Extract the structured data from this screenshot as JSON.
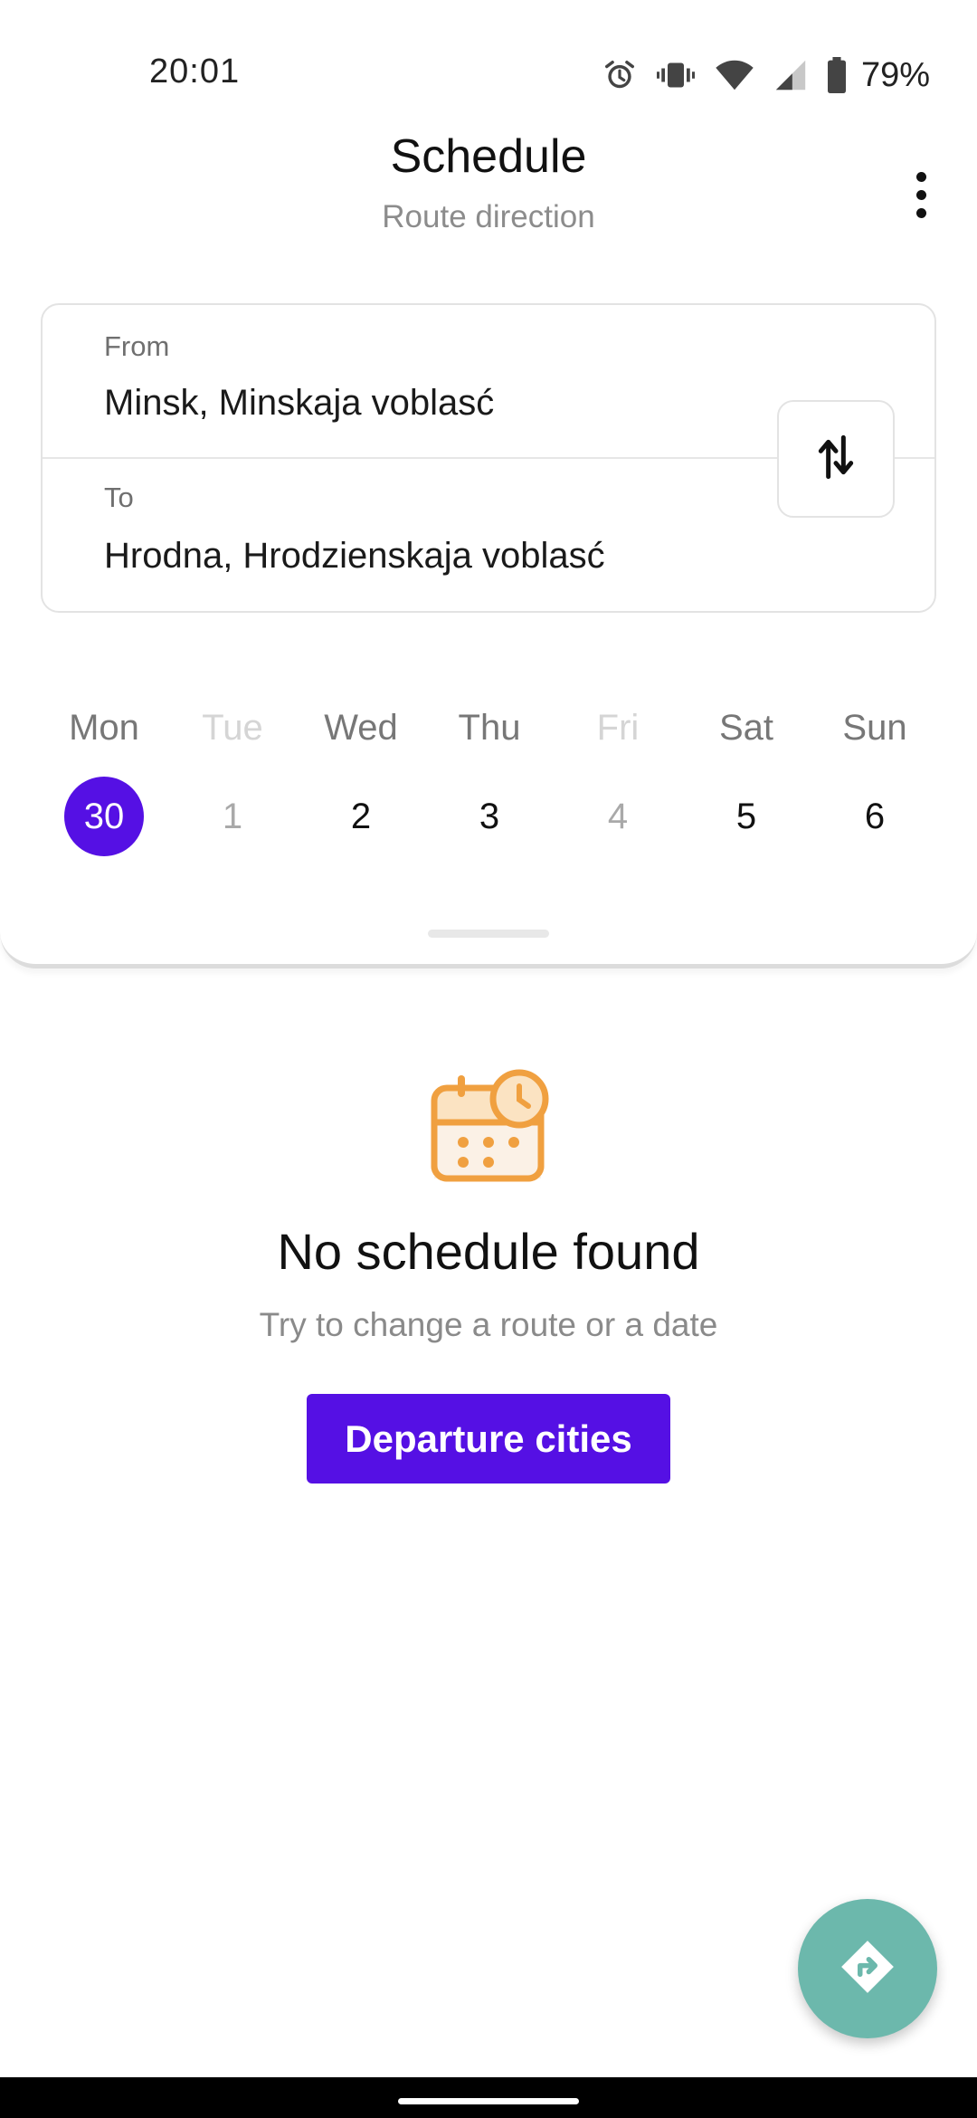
{
  "status_bar": {
    "time": "20:01",
    "battery_percent": "79%",
    "icons": [
      "alarm-icon",
      "vibrate-icon",
      "wifi-icon",
      "cell-signal-icon",
      "battery-icon"
    ]
  },
  "header": {
    "title": "Schedule",
    "subtitle": "Route direction",
    "menu_icon": "more-vertical-icon"
  },
  "route": {
    "from_label": "From",
    "from_value": "Minsk, Minskaja voblasć",
    "to_label": "To",
    "to_value": "Hrodna, Hrodzienskaja voblasć",
    "swap_icon": "swap-vertical-icon"
  },
  "week": {
    "days": [
      {
        "name": "Mon",
        "num": "30",
        "state": "selected"
      },
      {
        "name": "Tue",
        "num": "1",
        "state": "disabled"
      },
      {
        "name": "Wed",
        "num": "2",
        "state": "normal"
      },
      {
        "name": "Thu",
        "num": "3",
        "state": "normal"
      },
      {
        "name": "Fri",
        "num": "4",
        "state": "disabled"
      },
      {
        "name": "Sat",
        "num": "5",
        "state": "normal"
      },
      {
        "name": "Sun",
        "num": "6",
        "state": "normal"
      }
    ]
  },
  "empty_state": {
    "icon": "calendar-clock-icon",
    "title": "No schedule found",
    "subtitle": "Try to change a route or a date",
    "button_label": "Departure cities"
  },
  "fab": {
    "icon": "directions-icon"
  },
  "colors": {
    "accent": "#5510e4",
    "fab": "#6cb8ac",
    "empty_icon": "#f0a040"
  }
}
